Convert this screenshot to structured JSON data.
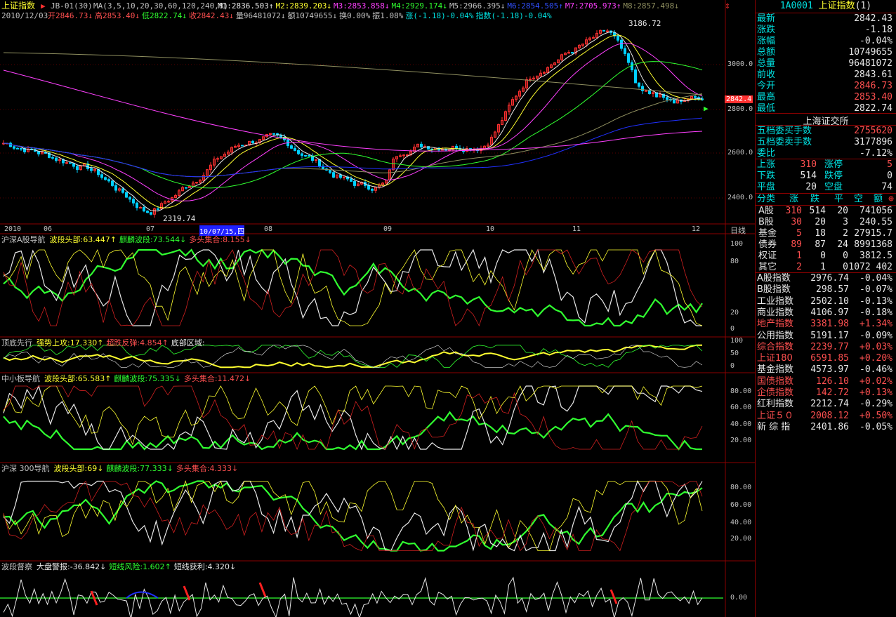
{
  "app": {
    "index_name": "上证指数",
    "mode": "JB-01(30)",
    "ma_params": "MA(3,5,10,20,30,60,120,240,8)",
    "date": "2010/12/03",
    "day_label": "日线"
  },
  "ma_legend": [
    {
      "text": "M1:2836.503↑",
      "color": "#e8e8e8"
    },
    {
      "text": "M2:2839.203↓",
      "color": "#ffff30"
    },
    {
      "text": "M3:2853.858↓",
      "color": "#ff40ff"
    },
    {
      "text": "M4:2929.174↓",
      "color": "#30ff30"
    },
    {
      "text": "M5:2966.395↓",
      "color": "#c0c0c0"
    },
    {
      "text": "M6:2854.505↑",
      "color": "#3050ff"
    },
    {
      "text": "M7:2705.973↑",
      "color": "#ff40ff"
    },
    {
      "text": "M8:2857.498↓",
      "color": "#909060"
    }
  ],
  "quote_line": [
    {
      "text": "开2846.73↓",
      "color": "#ff5050"
    },
    {
      "text": "高2853.40↓",
      "color": "#ff5050"
    },
    {
      "text": "低2822.74↓",
      "color": "#30ff30"
    },
    {
      "text": "收2842.43↓",
      "color": "#ff5050"
    },
    {
      "text": "量96481072↓",
      "color": "#c0c0c0"
    },
    {
      "text": "额10749655↓",
      "color": "#c0c0c0"
    },
    {
      "text": "换0.00%",
      "color": "#c0c0c0"
    },
    {
      "text": "振1.08%",
      "color": "#c0c0c0"
    },
    {
      "text": "涨(-1.18)-0.04%",
      "color": "#00e0e0"
    },
    {
      "text": "指数(-1.18)-0.04%",
      "color": "#00e0e0"
    }
  ],
  "price_axis": [
    "3000.0",
    "2800.0",
    "2600.0",
    "2400.0"
  ],
  "current_price_tag": "2842.4",
  "high_label": "3186.72",
  "low_label": "2319.74",
  "time_axis": [
    "2010",
    "06",
    "07",
    "10/07/15,四",
    "08",
    "09",
    "10",
    "11",
    "12"
  ],
  "panels": [
    {
      "title": "沪深A股导航",
      "legend": [
        {
          "text": "波段头部:63.447↑",
          "color": "#ffff30"
        },
        {
          "text": "麒麟波段:73.544↓",
          "color": "#30ff30"
        },
        {
          "text": "多头集合:8.155↓",
          "color": "#ff5050"
        }
      ],
      "ticks": [
        "100",
        "80",
        "20",
        "0"
      ]
    },
    {
      "title": "顶底先行",
      "legend": [
        {
          "text": "强势上攻:17.330↑",
          "color": "#ffff30"
        },
        {
          "text": "超跌反弹:4.854↑",
          "color": "#ff5050"
        },
        {
          "text": "底部区域:",
          "color": "#e8e8e8"
        }
      ],
      "ticks": [
        "100",
        "50",
        "0"
      ]
    },
    {
      "title": "中小板导航",
      "legend": [
        {
          "text": "波段头部:65.583↑",
          "color": "#ffff30"
        },
        {
          "text": "麒麟波段:75.335↓",
          "color": "#30ff30"
        },
        {
          "text": "多头集合:11.472↓",
          "color": "#ff5050"
        }
      ],
      "ticks": [
        "80.00",
        "60.00",
        "40.00",
        "20.00"
      ]
    },
    {
      "title": "沪深 300导航",
      "legend": [
        {
          "text": "波段头部:69↓",
          "color": "#ffff30"
        },
        {
          "text": "麒麟波段:77.333↓",
          "color": "#30ff30"
        },
        {
          "text": "多头集合:4.333↓",
          "color": "#ff5050"
        }
      ],
      "ticks": [
        "80.00",
        "60.00",
        "40.00",
        "20.00"
      ]
    },
    {
      "title": "波段督察",
      "legend": [
        {
          "text": "大盘警报:-36.842↓",
          "color": "#e8e8e8"
        },
        {
          "text": "短线风险:1.602↑",
          "color": "#30ff30"
        },
        {
          "text": "短线获利:4.320↓",
          "color": "#e8e8e8"
        }
      ],
      "ticks": [
        "0.00"
      ]
    }
  ],
  "sidebar": {
    "code": "1A0001",
    "name": "上证指数",
    "suffix": "(1)",
    "quote": [
      {
        "label": "最新",
        "value": "2842.43",
        "color": "white"
      },
      {
        "label": "涨跌",
        "value": "-1.18",
        "color": "white"
      },
      {
        "label": "涨幅",
        "value": "-0.04%",
        "color": "white"
      },
      {
        "label": "总额",
        "value": "10749655",
        "color": "white"
      },
      {
        "label": "总量",
        "value": "96481072",
        "color": "white"
      },
      {
        "label": "前收",
        "value": "2843.61",
        "color": "white"
      },
      {
        "label": "今开",
        "value": "2846.73",
        "color": "red"
      },
      {
        "label": "最高",
        "value": "2853.40",
        "color": "red"
      },
      {
        "label": "最低",
        "value": "2822.74",
        "color": "white"
      }
    ],
    "exchange": "上海证交所",
    "orders": [
      {
        "label": "五档委买手数",
        "value": "2755620",
        "color": "red"
      },
      {
        "label": "五档委卖手数",
        "value": "3177896",
        "color": "white"
      },
      {
        "label": "委比",
        "value": "-7.12%",
        "color": "white"
      }
    ],
    "breadth": [
      {
        "l1": "上涨",
        "v1": "310",
        "l2": "涨停",
        "v2": "5",
        "c": "red"
      },
      {
        "l1": "下跌",
        "v1": "514",
        "l2": "跌停",
        "v2": "0",
        "c": "white"
      },
      {
        "l1": "平盘",
        "v1": "20",
        "l2": "空盘",
        "v2": "74",
        "c": "white"
      }
    ],
    "class_header": [
      "分类",
      "涨",
      "跌",
      "平",
      "空",
      "额"
    ],
    "classes": [
      {
        "name": "A股",
        "up": "310",
        "down": "514",
        "flat": "20",
        "amt": "741056"
      },
      {
        "name": "B股",
        "up": "30",
        "down": "20",
        "flat": "3",
        "amt": "240.55"
      },
      {
        "name": "基金",
        "up": "5",
        "down": "18",
        "flat": "2",
        "amt": "27915.7"
      },
      {
        "name": "债券",
        "up": "89",
        "down": "87",
        "flat": "24",
        "amt": "8991368"
      },
      {
        "name": "权证",
        "up": "1",
        "down": "0",
        "flat": "0",
        "amt": "3812.5"
      },
      {
        "name": "其它",
        "up": "2",
        "down": "1",
        "flat": "0",
        "amt": "1072 402"
      }
    ],
    "indices": [
      {
        "name": "A股指数",
        "value": "2976.74",
        "chg": "-0.04%",
        "color": "white"
      },
      {
        "name": "B股指数",
        "value": "298.57",
        "chg": "-0.07%",
        "color": "white"
      },
      {
        "name": "工业指数",
        "value": "2502.10",
        "chg": "-0.13%",
        "color": "white"
      },
      {
        "name": "商业指数",
        "value": "4106.97",
        "chg": "-0.18%",
        "color": "white"
      },
      {
        "name": "地产指数",
        "value": "3381.98",
        "chg": "+1.34%",
        "color": "red"
      },
      {
        "name": "公用指数",
        "value": "5191.17",
        "chg": "-0.09%",
        "color": "white"
      },
      {
        "name": "综合指数",
        "value": "2239.77",
        "chg": "+0.03%",
        "color": "red"
      },
      {
        "name": "上证180",
        "value": "6591.85",
        "chg": "+0.20%",
        "color": "red"
      },
      {
        "name": "基金指数",
        "value": "4573.97",
        "chg": "-0.46%",
        "color": "white"
      },
      {
        "name": "国债指数",
        "value": "126.10",
        "chg": "+0.02%",
        "color": "red"
      },
      {
        "name": "企债指数",
        "value": "142.72",
        "chg": "+0.13%",
        "color": "red"
      },
      {
        "name": "红利指数",
        "value": "2212.74",
        "chg": "-0.29%",
        "color": "white"
      },
      {
        "name": "上证５０",
        "value": "2008.12",
        "chg": "+0.50%",
        "color": "red"
      },
      {
        "name": "新 综 指",
        "value": "2401.86",
        "chg": "-0.05%",
        "color": "white"
      }
    ]
  },
  "colors": {
    "up": "#ff3030",
    "down": "#00d0ff",
    "grid": "#8b0000",
    "bg": "#000000"
  }
}
